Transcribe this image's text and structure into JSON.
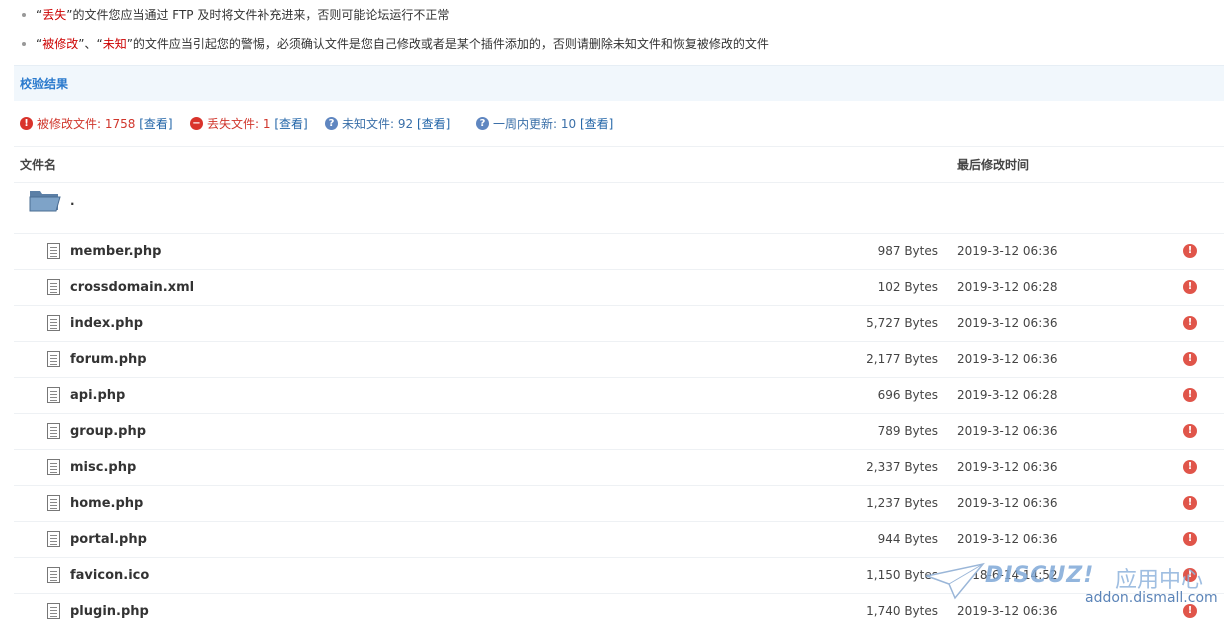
{
  "tips": [
    {
      "quote_open": "“",
      "emph": "丢失",
      "quote_close": "”",
      "text": "的文件您应当通过 FTP 及时将文件补充进来，否则可能论坛运行不正常"
    },
    {
      "quote1_open": "“",
      "emph1": "被修改",
      "quote1_close": "”",
      "mid": "、",
      "quote2_open": "“",
      "emph2": "未知",
      "quote2_close": "”",
      "text": "的文件应当引起您的警惕，必须确认文件是您自己修改或者是某个插件添加的，否则请删除未知文件和恢复被修改的文件"
    }
  ],
  "result_header": "校验结果",
  "summary": {
    "modified": {
      "label": "被修改文件: 1758",
      "link": "[查看]"
    },
    "missing": {
      "label": "丢失文件: 1",
      "link": "[查看]"
    },
    "unknown": {
      "label": "未知文件: 92",
      "link": "[查看]"
    },
    "week": {
      "label": "一周内更新: 10",
      "link": "[查看]"
    }
  },
  "columns": {
    "name": "文件名",
    "modified_time": "最后修改时间"
  },
  "folder_label": ".",
  "files": [
    {
      "name": "member.php",
      "size": "987 Bytes",
      "date": "2019-3-12 06:36"
    },
    {
      "name": "crossdomain.xml",
      "size": "102 Bytes",
      "date": "2019-3-12 06:28"
    },
    {
      "name": "index.php",
      "size": "5,727 Bytes",
      "date": "2019-3-12 06:36"
    },
    {
      "name": "forum.php",
      "size": "2,177 Bytes",
      "date": "2019-3-12 06:36"
    },
    {
      "name": "api.php",
      "size": "696 Bytes",
      "date": "2019-3-12 06:28"
    },
    {
      "name": "group.php",
      "size": "789 Bytes",
      "date": "2019-3-12 06:36"
    },
    {
      "name": "misc.php",
      "size": "2,337 Bytes",
      "date": "2019-3-12 06:36"
    },
    {
      "name": "home.php",
      "size": "1,237 Bytes",
      "date": "2019-3-12 06:36"
    },
    {
      "name": "portal.php",
      "size": "944 Bytes",
      "date": "2019-3-12 06:36"
    },
    {
      "name": "favicon.ico",
      "size": "1,150 Bytes",
      "date": "2018-6-14 14:52"
    },
    {
      "name": "plugin.php",
      "size": "1,740 Bytes",
      "date": "2019-3-12 06:36"
    }
  ],
  "watermark": {
    "logo": "DISCUZ!",
    "cn": "应用中心",
    "url": "addon.dismall.com"
  },
  "colors": {
    "red": "#d0362c",
    "blue_link": "#2366a8",
    "header_bg": "#f1f7fc",
    "header_text": "#2b7acd"
  },
  "icons": {
    "modified": "exclamation-circle-icon",
    "missing": "minus-circle-icon",
    "unknown": "question-circle-icon",
    "file": "document-icon",
    "folder": "folder-open-icon",
    "flag": "warning-icon"
  }
}
